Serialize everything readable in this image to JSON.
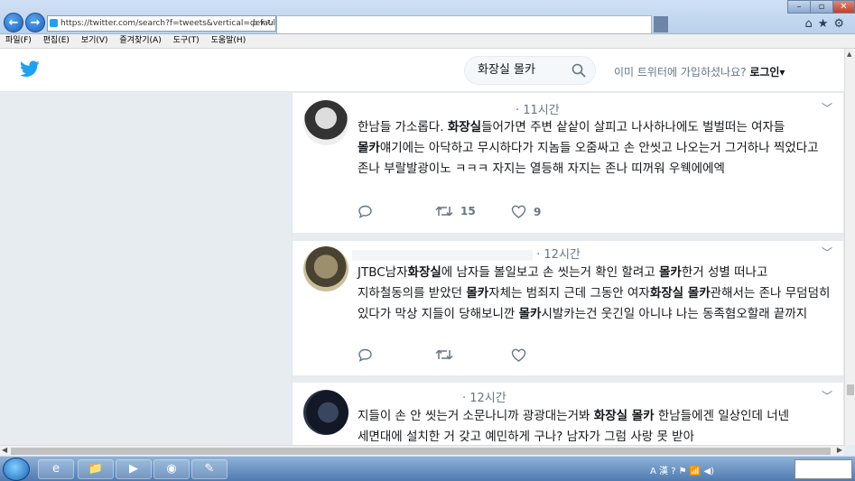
{
  "browser": {
    "address": "https://twitter.com/search?f=tweets&vertical=default",
    "address_tools": "ρ ▾ ↻",
    "back_glyph": "←",
    "forward_glyph": "→",
    "window_min": "–",
    "window_max": "▫",
    "window_close": "✕",
    "toolbar_icons": "⌂★⚙",
    "menu": [
      "파일(F)",
      "편집(E)",
      "보기(V)",
      "즐겨찾기(A)",
      "도구(T)",
      "도움말(H)"
    ]
  },
  "twitter": {
    "search_query": "화장실 몰카",
    "login_prompt": "이미 트위터에 가입하셨나요?",
    "login_link": "로그인▾",
    "colors": {
      "brand": "#1da1f2",
      "background": "#e6ecf0"
    }
  },
  "tweets": [
    {
      "time": "· 11시간",
      "text_parts": [
        {
          "t": "한남들 가소롭다. ",
          "b": false
        },
        {
          "t": "화장실",
          "b": true
        },
        {
          "t": "들어가면 주변 샅샅이 살피고 나사하나에도 벌벌떠는 여자들 ",
          "b": false
        },
        {
          "t": "몰카",
          "b": true
        },
        {
          "t": "얘기에는 아닥하고 무시하다가 지놈들 오줌싸고 손 안씻고 나오는거 그거하나 찍었다고 존나 부랄발광이노 ㅋㅋㅋ 자지는 열등해 자지는 존나 띠꺼워 우웩에에엑",
          "b": false
        }
      ],
      "retweets": "15",
      "likes": "9"
    },
    {
      "time": "· 12시간",
      "text_parts": [
        {
          "t": "JTBC남자",
          "b": false
        },
        {
          "t": "화장실",
          "b": true
        },
        {
          "t": "에 남자들 볼일보고 손 씻는거 확인 할려고 ",
          "b": false
        },
        {
          "t": "몰카",
          "b": true
        },
        {
          "t": "한거 성별 떠나고 지하철동의를 받았던 ",
          "b": false
        },
        {
          "t": "몰카",
          "b": true
        },
        {
          "t": "자체는 범죄지 근데 그동안 여자",
          "b": false
        },
        {
          "t": "화장실 몰카",
          "b": true
        },
        {
          "t": "관해서는 존나 무덤덤히 있다가 막상 지들이 당해보니깐 ",
          "b": false
        },
        {
          "t": "몰카",
          "b": true
        },
        {
          "t": "시발카는건 웃긴일 아니냐 나는 동족혐오할래 끝까지",
          "b": false
        }
      ],
      "retweets": "",
      "likes": ""
    },
    {
      "time": "· 12시간",
      "text_parts": [
        {
          "t": "지들이 손 안 씻는거 소문나니까 광광대는거봐 ",
          "b": false
        },
        {
          "t": "화장실 몰카",
          "b": true
        },
        {
          "t": " 한남들에겐 일상인데 너넨 세면대에 설치한 거 갖고 예민하게 구나? 남자가 그럼 사랑 못 받아",
          "b": false
        }
      ],
      "retweets": "",
      "likes": ""
    }
  ],
  "taskbar": {
    "tray_text": "A 漢 ? ⚑ 📶 ◀)",
    "apps": [
      "e",
      "📁",
      "▶",
      "◉",
      "✎"
    ]
  }
}
